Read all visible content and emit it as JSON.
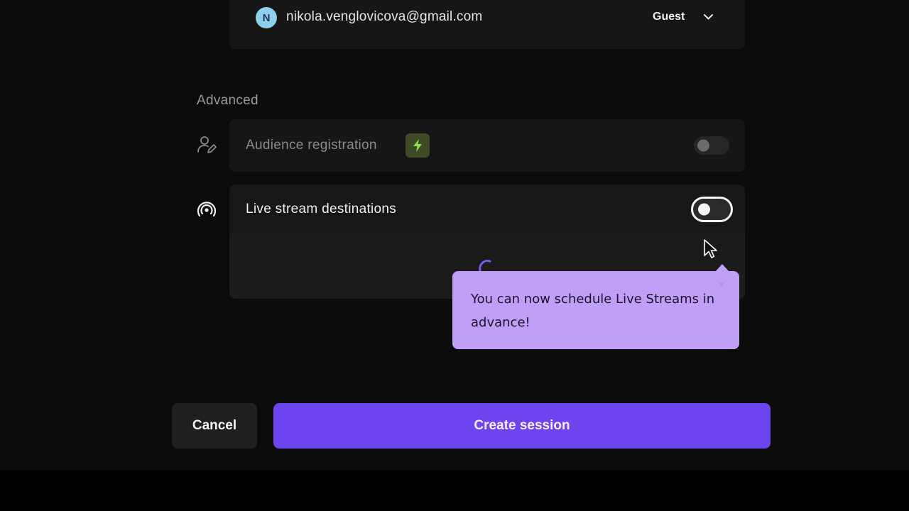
{
  "guest": {
    "avatar_initial": "N",
    "email": "nikola.venglovicova@gmail.com",
    "role": "Guest"
  },
  "advanced": {
    "section_title": "Advanced",
    "audience_registration": {
      "label": "Audience registration",
      "enabled": false
    },
    "live_stream_destinations": {
      "label": "Live stream destinations",
      "enabled": false
    }
  },
  "tooltip": {
    "text": "You can now schedule Live Streams in advance!",
    "close": "×"
  },
  "actions": {
    "cancel_label": "Cancel",
    "create_label": "Create session"
  },
  "colors": {
    "accent": "#6c45ee",
    "tooltip_bg": "#c09ff7",
    "avatar_bg": "#8ecfee",
    "bolt": "#8ee04a"
  },
  "icons": [
    "chevron-down-icon",
    "user-edit-icon",
    "bolt-icon",
    "broadcast-icon",
    "loading-spinner-icon",
    "close-icon",
    "mouse-cursor-icon"
  ]
}
